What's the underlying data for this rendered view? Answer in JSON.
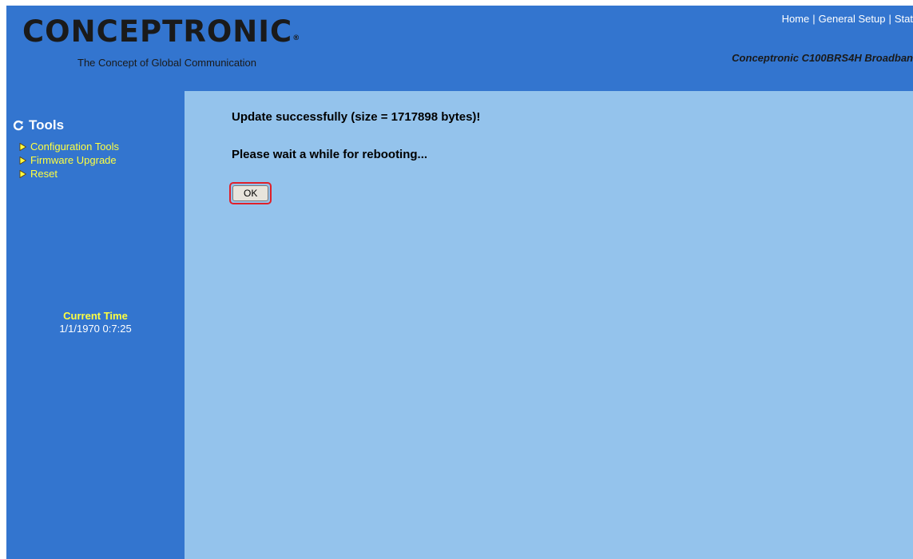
{
  "header": {
    "logo_text": "CONCEPTRONIC",
    "logo_mark": "®",
    "tagline": "The Concept of Global Communication",
    "nav": [
      "Home",
      "General Setup",
      "Stat"
    ],
    "model": "Conceptronic C100BRS4H Broadban"
  },
  "sidebar": {
    "section_title": "Tools",
    "items": [
      {
        "label": "Configuration Tools"
      },
      {
        "label": "Firmware Upgrade"
      },
      {
        "label": "Reset"
      }
    ],
    "current_time_label": "Current Time",
    "current_time_value": "1/1/1970 0:7:25"
  },
  "main": {
    "message_1": "Update successfully (size = 1717898 bytes)!",
    "message_2": "Please wait a while for rebooting...",
    "ok_label": "OK"
  },
  "colors": {
    "frame_blue": "#3375cf",
    "content_blue": "#94c3ec",
    "menu_yellow": "#ffff40"
  }
}
